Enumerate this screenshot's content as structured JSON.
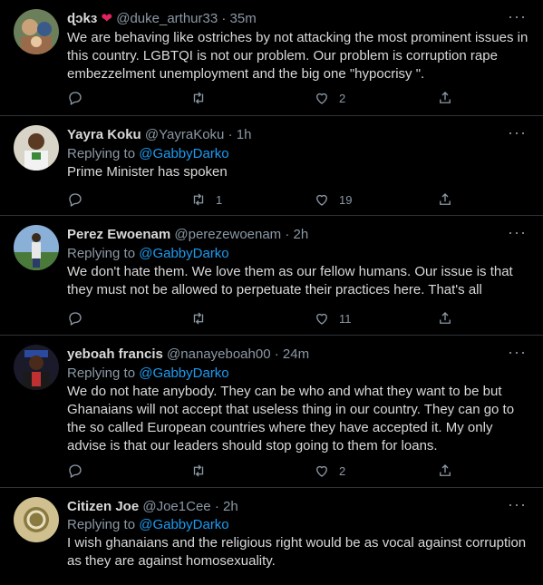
{
  "tweets": [
    {
      "name": "ɖɔkɜ",
      "name_emoji": "❤",
      "handle": "@duke_arthur33",
      "time": "35m",
      "replying_label": "",
      "replying_to": "",
      "text": "We are behaving like ostriches by not attacking the most prominent issues in this country. LGBTQI is not our problem. Our problem is corruption rape embezzelment unemployment and the big one \"hypocrisy \".",
      "reply_count": "",
      "retweet_count": "",
      "like_count": "2"
    },
    {
      "name": "Yayra Koku",
      "handle": "@YayraKoku",
      "time": "1h",
      "replying_label": "Replying to",
      "replying_to": "@GabbyDarko",
      "text": "Prime Minister has spoken",
      "reply_count": "",
      "retweet_count": "1",
      "like_count": "19"
    },
    {
      "name": "Perez Ewoenam",
      "handle": "@perezewoenam",
      "time": "2h",
      "replying_label": "Replying to",
      "replying_to": "@GabbyDarko",
      "text": "We don't hate them. We love them as our fellow humans. Our issue is that they must not be allowed to perpetuate their practices here. That's all",
      "reply_count": "",
      "retweet_count": "",
      "like_count": "11"
    },
    {
      "name": "yeboah francis",
      "handle": "@nanayeboah00",
      "time": "24m",
      "replying_label": "Replying to",
      "replying_to": "@GabbyDarko",
      "text": "We do not hate anybody. They can be who and what they want to be but Ghanaians will not accept that useless thing in our country. They can go to the so called European countries where they have accepted it. My only advise is that our leaders should stop going to them for loans.",
      "reply_count": "",
      "retweet_count": "",
      "like_count": "2"
    },
    {
      "name": "Citizen Joe",
      "handle": "@Joe1Cee",
      "time": "2h",
      "replying_label": "Replying to",
      "replying_to": "@GabbyDarko",
      "text": "I wish ghanaians and the religious right would be as vocal against corruption as they are against homosexuality.",
      "reply_count": "",
      "retweet_count": "",
      "like_count": ""
    }
  ],
  "separator": "·",
  "more_glyph": "···",
  "icons": [
    "reply-icon",
    "retweet-icon",
    "like-icon",
    "share-icon",
    "more-icon"
  ],
  "colors": {
    "background": "#000000",
    "text": "#d9d9d9",
    "muted": "#8b98a5",
    "link": "#1d9bf0",
    "heart": "#e0245e",
    "divider": "#2f3336"
  }
}
